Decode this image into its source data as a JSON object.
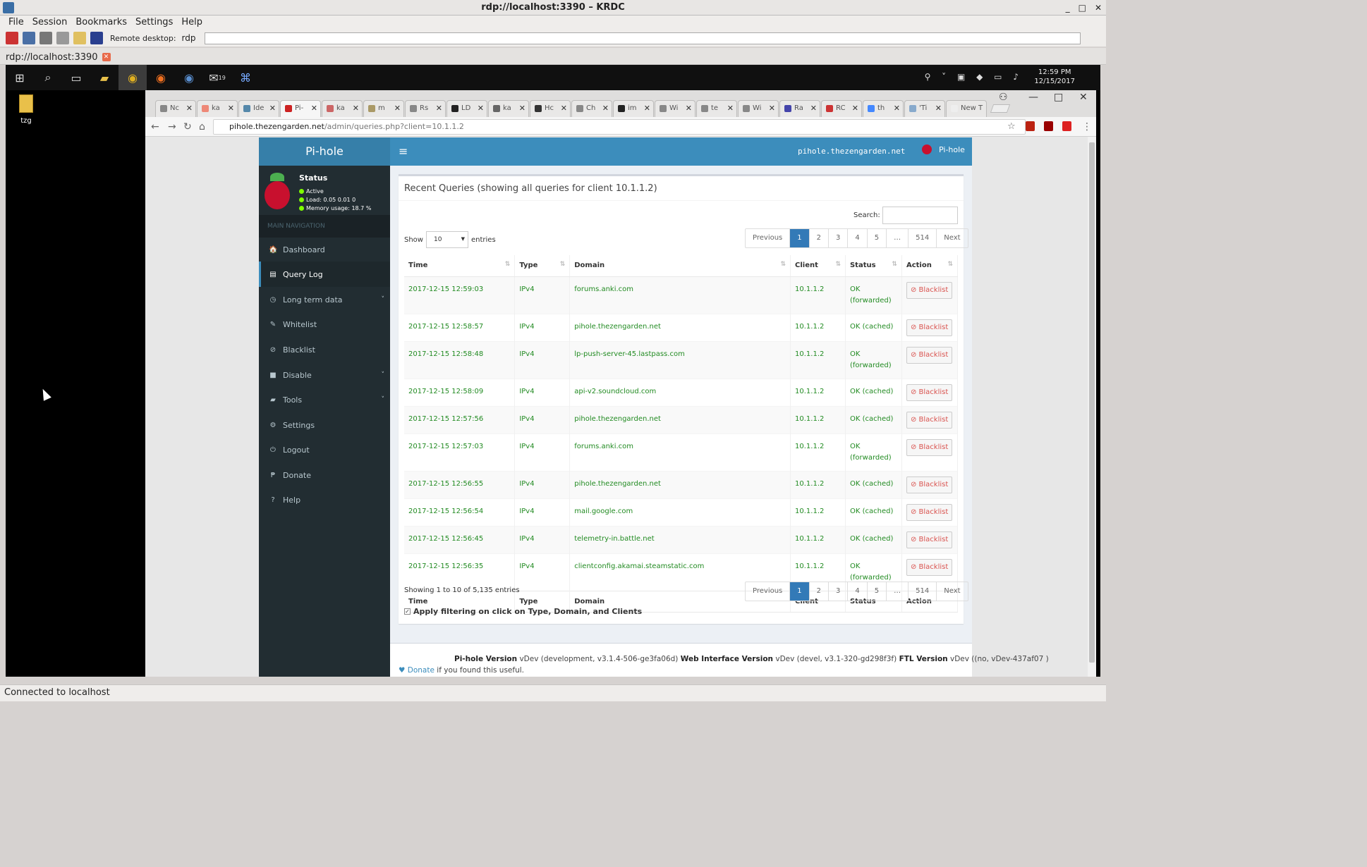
{
  "krdc": {
    "title": "rdp://localhost:3390 – KRDC",
    "menus": [
      "File",
      "Session",
      "Bookmarks",
      "Settings",
      "Help"
    ],
    "remote_label": "Remote desktop:",
    "protocol": "rdp",
    "tab": "rdp://localhost:3390",
    "status": "Connected to localhost",
    "win_buttons": [
      "_",
      "□",
      "✕"
    ]
  },
  "windows": {
    "desktop_icon": "tzg",
    "clock_time": "12:59 PM",
    "clock_date": "12/15/2017",
    "mail_badge": "19"
  },
  "chrome": {
    "tabs": [
      "Nc",
      "ka",
      "Ide",
      "Pi-",
      "ka",
      "m",
      "Rs",
      "LD",
      "ka",
      "Hc",
      "Ch",
      "im",
      "Wi",
      "te",
      "Wi",
      "Ra",
      "RC",
      "th",
      "'Ti",
      "New T"
    ],
    "url_host": "pihole.thezengarden.net",
    "url_path": "/admin/queries.php?client=10.1.1.2"
  },
  "pihole": {
    "logo": "Pi-hole",
    "host": "pihole.thezengarden.net",
    "user": "Pi-hole",
    "status": {
      "title": "Status",
      "active": "Active",
      "load": "Load:  0.05  0.01  0",
      "memory": "Memory usage:  18.7 %"
    },
    "nav_header": "MAIN NAVIGATION",
    "nav": [
      {
        "label": "Dashboard",
        "icon": "🏠"
      },
      {
        "label": "Query Log",
        "icon": "▤"
      },
      {
        "label": "Long term data",
        "icon": "◷"
      },
      {
        "label": "Whitelist",
        "icon": "✎"
      },
      {
        "label": "Blacklist",
        "icon": "⊘"
      },
      {
        "label": "Disable",
        "icon": "■"
      },
      {
        "label": "Tools",
        "icon": "▰"
      },
      {
        "label": "Settings",
        "icon": "⚙"
      },
      {
        "label": "Logout",
        "icon": "⏻"
      },
      {
        "label": "Donate",
        "icon": "₱"
      },
      {
        "label": "Help",
        "icon": "?"
      }
    ],
    "box_title": "Recent Queries (showing all queries for client 10.1.1.2)",
    "search_label": "Search:",
    "show_label": "Show",
    "show_value": "10",
    "entries_label": "entries",
    "pagination": [
      "Previous",
      "1",
      "2",
      "3",
      "4",
      "5",
      "…",
      "514",
      "Next"
    ],
    "columns": [
      "Time",
      "Type",
      "Domain",
      "Client",
      "Status",
      "Action"
    ],
    "rows": [
      {
        "time": "2017-12-15 12:59:03",
        "type": "IPv4",
        "domain": "forums.anki.com",
        "client": "10.1.1.2",
        "status": "OK (forwarded)"
      },
      {
        "time": "2017-12-15 12:58:57",
        "type": "IPv4",
        "domain": "pihole.thezengarden.net",
        "client": "10.1.1.2",
        "status": "OK (cached)"
      },
      {
        "time": "2017-12-15 12:58:48",
        "type": "IPv4",
        "domain": "lp-push-server-45.lastpass.com",
        "client": "10.1.1.2",
        "status": "OK (forwarded)"
      },
      {
        "time": "2017-12-15 12:58:09",
        "type": "IPv4",
        "domain": "api-v2.soundcloud.com",
        "client": "10.1.1.2",
        "status": "OK (cached)"
      },
      {
        "time": "2017-12-15 12:57:56",
        "type": "IPv4",
        "domain": "pihole.thezengarden.net",
        "client": "10.1.1.2",
        "status": "OK (cached)"
      },
      {
        "time": "2017-12-15 12:57:03",
        "type": "IPv4",
        "domain": "forums.anki.com",
        "client": "10.1.1.2",
        "status": "OK (forwarded)"
      },
      {
        "time": "2017-12-15 12:56:55",
        "type": "IPv4",
        "domain": "pihole.thezengarden.net",
        "client": "10.1.1.2",
        "status": "OK (cached)"
      },
      {
        "time": "2017-12-15 12:56:54",
        "type": "IPv4",
        "domain": "mail.google.com",
        "client": "10.1.1.2",
        "status": "OK (cached)"
      },
      {
        "time": "2017-12-15 12:56:45",
        "type": "IPv4",
        "domain": "telemetry-in.battle.net",
        "client": "10.1.1.2",
        "status": "OK (cached)"
      },
      {
        "time": "2017-12-15 12:56:35",
        "type": "IPv4",
        "domain": "clientconfig.akamai.steamstatic.com",
        "client": "10.1.1.2",
        "status": "OK (forwarded)"
      }
    ],
    "blacklist_btn": "⊘ Blacklist",
    "showing": "Showing 1 to 10 of 5,135 entries",
    "apply_filter": "Apply filtering on click on Type, Domain, and Clients",
    "footer": {
      "v1_label": "Pi-hole Version",
      "v1": "vDev (development, v3.1.4-506-ge3fa06d)",
      "v2_label": "Web Interface Version",
      "v2": "vDev (devel, v3.1-320-gd298f3f)",
      "v3_label": "FTL Version",
      "v3": "vDev ((no, vDev-437af07 )",
      "donate": "Donate",
      "donate_suffix": " if you found this useful."
    }
  }
}
